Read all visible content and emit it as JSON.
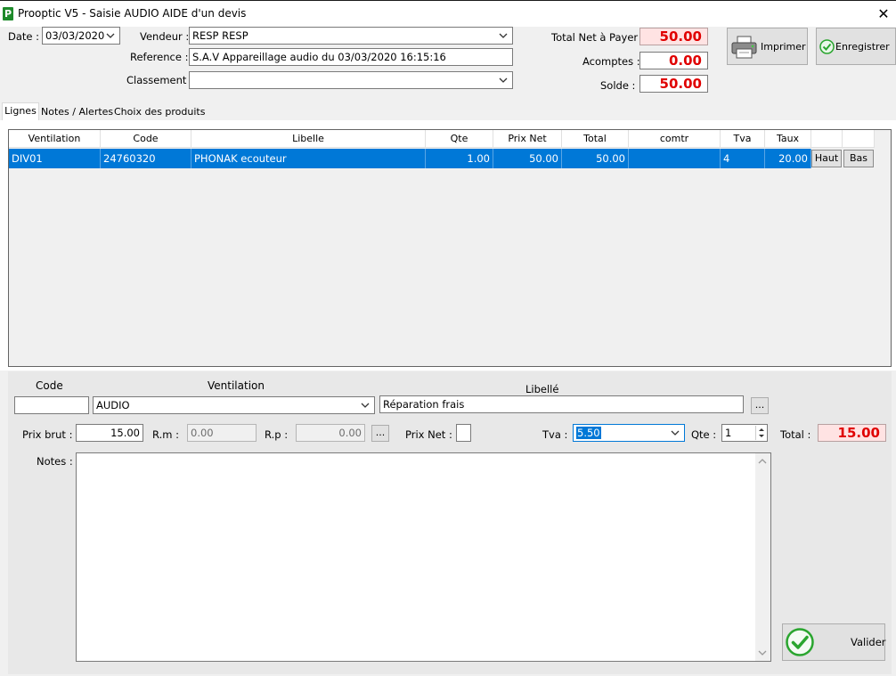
{
  "window": {
    "title": "Prooptic V5 - Saisie AUDIO AIDE d'un devis",
    "logo_letter": "P",
    "close_glyph": "✕"
  },
  "header": {
    "date_label": "Date :",
    "date_value": "03/03/2020",
    "vendeur_label": "Vendeur :",
    "vendeur_value": "RESP RESP",
    "reference_label": "Reference :",
    "reference_value": "S.A.V Appareillage audio du 03/03/2020 16:15:16",
    "classement_label": "Classement :",
    "classement_value": "",
    "total_net_label": "Total Net à Payer :",
    "total_net_value": "50.00",
    "acomptes_label": "Acomptes :",
    "acomptes_value": "0.00",
    "solde_label": "Solde :",
    "solde_value": "50.00",
    "print_button": "Imprimer",
    "save_button": "Enregistrer"
  },
  "tabs": [
    {
      "label": "Lignes",
      "active": true
    },
    {
      "label": "Notes / Alertes",
      "active": false
    },
    {
      "label": "Choix des produits",
      "active": false
    }
  ],
  "grid": {
    "columns": [
      "Ventilation",
      "Code",
      "Libelle",
      "Qte",
      "Prix Net",
      "Total",
      "comtr",
      "Tva",
      "Taux"
    ],
    "rows": [
      {
        "ventilation": "DIV01",
        "code": "24760320",
        "libelle": "PHONAK ecouteur",
        "qte": "1.00",
        "prix_net": "50.00",
        "total": "50.00",
        "comtr": "",
        "tva": "4",
        "taux": "20.00",
        "haut_label": "Haut",
        "bas_label": "Bas"
      }
    ]
  },
  "line_editor": {
    "code_label": "Code",
    "code_value": "",
    "ventilation_label": "Ventilation",
    "ventilation_value": "AUDIO",
    "libelle_label": "Libellé",
    "libelle_value": "Réparation frais",
    "ellipsis": "...",
    "prix_brut_label": "Prix brut :",
    "prix_brut_value": "15.00",
    "rm_label": "R.m :",
    "rm_value": "0.00",
    "rp_label": "R.p :",
    "rp_value": "0.00",
    "prix_net_label": "Prix Net :",
    "tva_label": "Tva :",
    "tva_value": "5.50",
    "qte_label": "Qte :",
    "qte_value": "1",
    "total_label": "Total :",
    "total_value": "15.00",
    "notes_label": "Notes :",
    "notes_value": "",
    "valider_button": "Valider"
  },
  "colors": {
    "selection": "#0078d7",
    "money_red": "#e00000",
    "valid_green": "#2aa52f"
  }
}
